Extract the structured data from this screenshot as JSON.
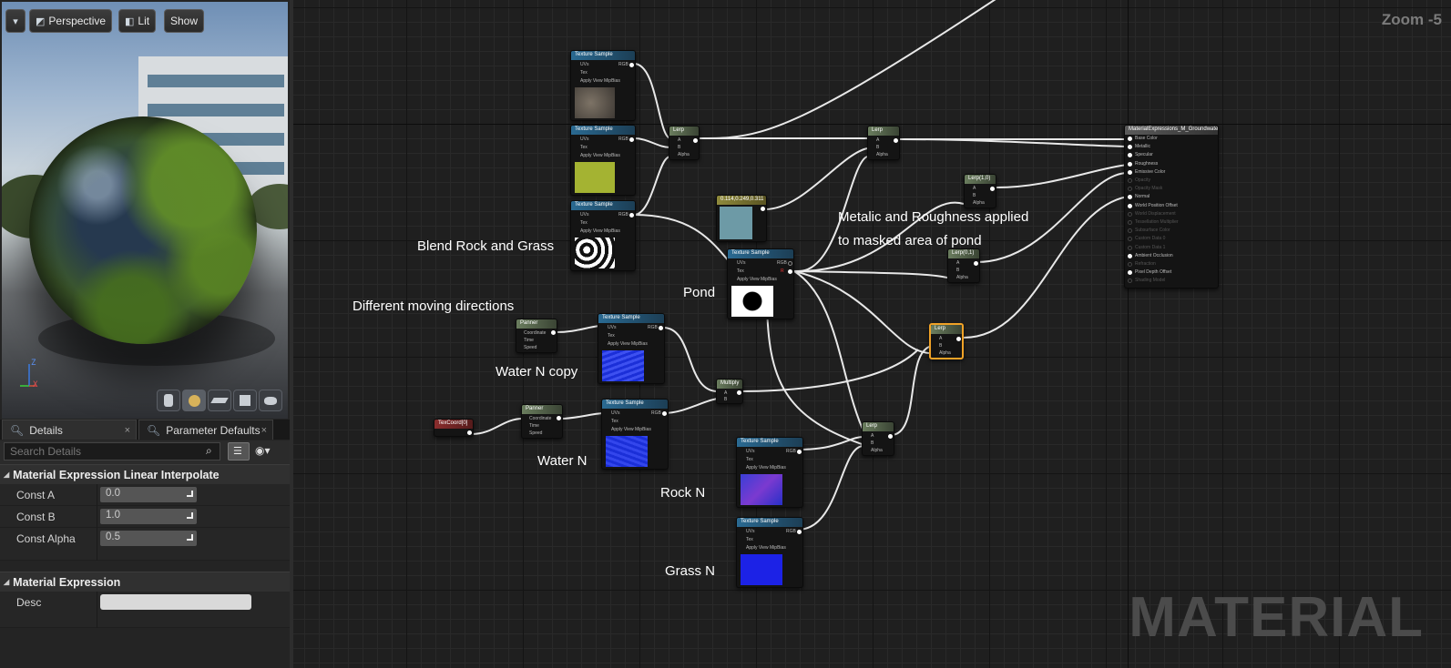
{
  "viewport": {
    "perspective_label": "Perspective",
    "lit_label": "Lit",
    "show_label": "Show",
    "axis_z": "Z",
    "axis_x": "X"
  },
  "tabs": [
    {
      "label": "Details",
      "close": "×"
    },
    {
      "label": "Parameter Defaults",
      "close": "×"
    }
  ],
  "details": {
    "search_placeholder": "Search Details",
    "section1": "Material Expression Linear Interpolate",
    "props": [
      {
        "label": "Const A",
        "value": "0.0"
      },
      {
        "label": "Const B",
        "value": "1.0"
      },
      {
        "label": "Const Alpha",
        "value": "0.5"
      }
    ],
    "section2": "Material Expression",
    "desc_label": "Desc",
    "desc_value": ""
  },
  "graph": {
    "zoom": "Zoom -5",
    "watermark": "MATERIAL",
    "notes": {
      "blend": "Blend Rock and Grass",
      "moving": "Different moving directions",
      "pond": "Pond",
      "metalic": "Metalic and Roughness applied",
      "masked": "to masked area of pond",
      "water_copy": "Water N copy",
      "water": "Water N",
      "rock": "Rock N",
      "grass": "Grass N"
    },
    "node_titles": {
      "texture_sample": "Texture Sample",
      "lerp": "Lerp",
      "lerp_10": "Lerp(1,0)",
      "lerp_01": "Lerp(0,1)",
      "panner": "Panner",
      "multiply": "Multiply",
      "texcoord": "TexCoord[0]",
      "vector": "0.114,0.249,0.311",
      "output": "MaterialExpressions_M_Groundwater"
    },
    "tex_pins_in": [
      "UVs",
      "Tex",
      "Apply View MipBias"
    ],
    "tex_pins_out": [
      "RGB",
      "R",
      "G",
      "B",
      "A",
      "RGBA"
    ],
    "lerp_pins": [
      "A",
      "B",
      "Alpha"
    ],
    "panner_pins": [
      "Coordinate",
      "Time",
      "Speed"
    ],
    "output_pins": [
      "Base Color",
      "Metallic",
      "Specular",
      "Roughness",
      "Emissive Color",
      "Opacity",
      "Opacity Mask",
      "Normal",
      "World Position Offset",
      "World Displacement",
      "Tessellation Multiplier",
      "Subsurface Color",
      "Custom Data 0",
      "Custom Data 1",
      "Ambient Occlusion",
      "Refraction",
      "Pixel Depth Offset",
      "Shading Model"
    ],
    "output_active": [
      true,
      true,
      true,
      true,
      true,
      false,
      false,
      true,
      true,
      false,
      false,
      false,
      false,
      false,
      true,
      false,
      true,
      false
    ]
  }
}
